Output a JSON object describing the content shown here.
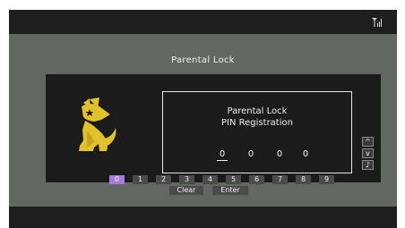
{
  "header": {
    "title": "Parental Lock"
  },
  "pin_panel": {
    "title": "Parental Lock",
    "subtitle": "PIN Registration",
    "digits": [
      "0",
      "0",
      "0",
      "0"
    ]
  },
  "side_controls": {
    "up": "^",
    "down": "v",
    "music": "♪"
  },
  "keypad": {
    "keys": [
      "0",
      "1",
      "2",
      "3",
      "4",
      "5",
      "6",
      "7",
      "8",
      "9"
    ],
    "selected": "0",
    "clear_label": "Clear",
    "enter_label": "Enter"
  },
  "colors": {
    "background": "#626762",
    "panel": "#1b1b1b",
    "selection": "#a87bd6",
    "mascot": "#e3c12a"
  }
}
